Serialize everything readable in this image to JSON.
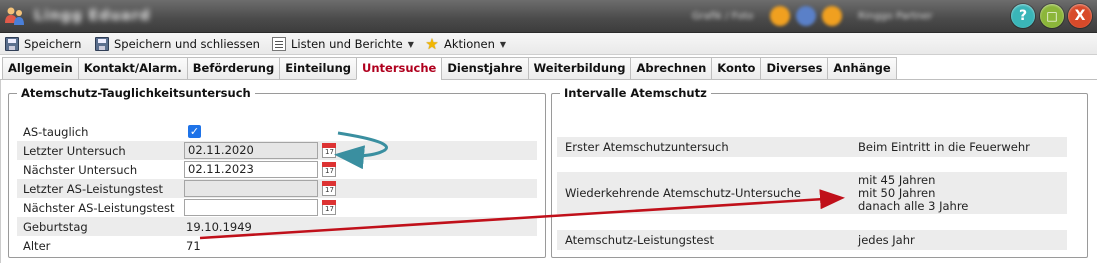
{
  "window": {
    "title": "Lingg Eduard",
    "user_text": "Grafik / Foto",
    "user_text2": "Ringgo Partner",
    "buttons": {
      "help": "?",
      "maximize": "□",
      "close": "X"
    }
  },
  "toolbar": {
    "save": "Speichern",
    "save_close": "Speichern und schliessen",
    "lists": "Listen und Berichte",
    "actions": "Aktionen"
  },
  "tabs": [
    "Allgemein",
    "Kontakt/Alarm.",
    "Beförderung",
    "Einteilung",
    "Untersuche",
    "Dienstjahre",
    "Weiterbildung",
    "Abrechnen",
    "Konto",
    "Diverses",
    "Anhänge"
  ],
  "active_tab": "Untersuche",
  "left_panel": {
    "legend": "Atemschutz-Tauglichkeitsuntersuch",
    "as_tauglich_label": "AS-tauglich",
    "as_tauglich_checked": true,
    "letzter_untersuch_label": "Letzter Untersuch",
    "letzter_untersuch_value": "02.11.2020",
    "naechster_untersuch_label": "Nächster Untersuch",
    "naechster_untersuch_value": "02.11.2023",
    "letzter_as_label": "Letzter AS-Leistungstest",
    "letzter_as_value": "",
    "naechster_as_label": "Nächster AS-Leistungstest",
    "naechster_as_value": "",
    "geburtstag_label": "Geburtstag",
    "geburtstag_value": "19.10.1949",
    "alter_label": "Alter",
    "alter_value": "71"
  },
  "right_panel": {
    "legend": "Intervalle Atemschutz",
    "rows": [
      {
        "label": "Erster Atemschutzuntersuch",
        "value": [
          "Beim Eintritt in die Feuerwehr"
        ]
      },
      {
        "label": "Wiederkehrende Atemschutz-Untersuche",
        "value": [
          "mit 45 Jahren",
          "mit 50 Jahren",
          "danach alle 3 Jahre"
        ]
      },
      {
        "label": "Atemschutz-Leistungstest",
        "value": [
          "jedes Jahr"
        ]
      }
    ]
  },
  "calendar_icon_text": "17",
  "colors": {
    "active_tab": "#b0001e",
    "checkbox": "#1e73e8",
    "arrow_red": "#c0101a",
    "arrow_teal": "#3a8fa0",
    "row_shade": "#ececec"
  }
}
